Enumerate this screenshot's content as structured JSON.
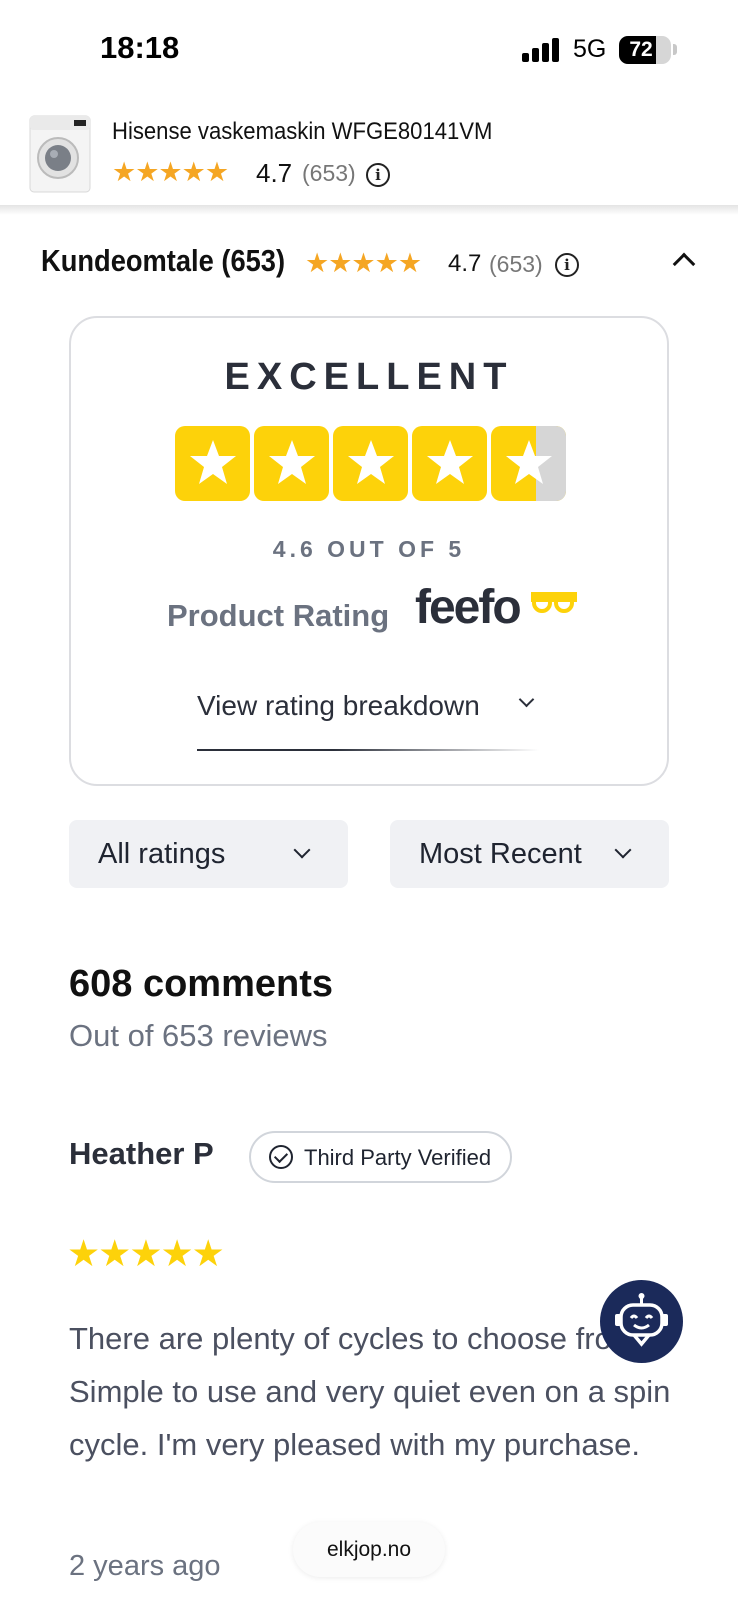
{
  "status_bar": {
    "time": "18:18",
    "network": "5G",
    "battery": "72",
    "battery_level": 0.72
  },
  "product": {
    "title": "Hisense vaskemaskin WFGE80141VM",
    "stars": "★★★★★",
    "score": "4.7",
    "count": "(653)",
    "info_icon": "i"
  },
  "reviews_section": {
    "heading": "Kundeomtale (653)",
    "stars": "★★★★★",
    "score": "4.7",
    "count": "(653)",
    "info_icon": "i"
  },
  "feefo": {
    "label": "EXCELLENT",
    "rating_value": 4.6,
    "out_of": "4.6 OUT OF 5",
    "product_rating": "Product Rating",
    "logo": "feefo",
    "breakdown_link": "View rating breakdown",
    "star_color": "#fdd20a"
  },
  "filters": {
    "rating_filter": "All ratings",
    "sort_filter": "Most Recent"
  },
  "summary": {
    "comments": "608 comments",
    "out_of": "Out of 653 reviews"
  },
  "review": {
    "name": "Heather P",
    "badge": "Third Party Verified",
    "stars": "★★★★★",
    "rating": 5,
    "text": "There are plenty of cycles to choose from. Simple to use and very quiet even on a spin cycle. I'm very pleased with my purchase.",
    "date": "2 years ago"
  },
  "chatbot": {
    "icon": "robot-icon"
  },
  "browser": {
    "url": "elkjop.no"
  },
  "colors": {
    "accent_star": "#f5a623",
    "feefo_yellow": "#fdd20a",
    "chatbot_bg": "#1b2a5a"
  }
}
